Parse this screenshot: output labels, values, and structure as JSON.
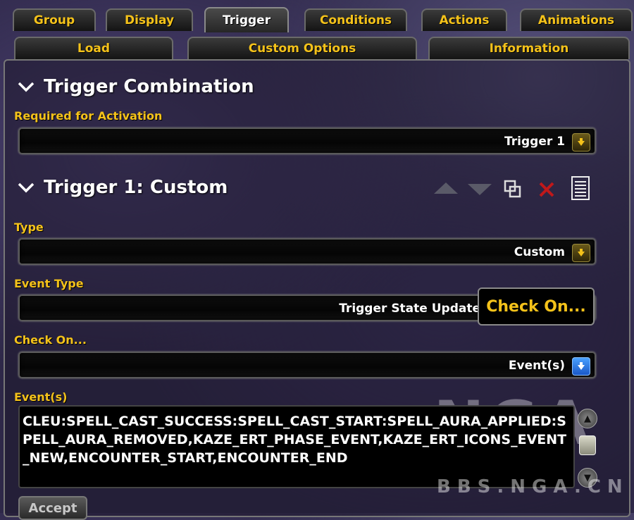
{
  "tabs_row1": [
    {
      "label": "Group",
      "active": false
    },
    {
      "label": "Display",
      "active": false
    },
    {
      "label": "Trigger",
      "active": true
    },
    {
      "label": "Conditions",
      "active": false
    },
    {
      "label": "Actions",
      "active": false
    },
    {
      "label": "Animations",
      "active": false
    }
  ],
  "tabs_row2": [
    {
      "label": "Load"
    },
    {
      "label": "Custom Options"
    },
    {
      "label": "Information"
    }
  ],
  "trigger_combination": {
    "header": "Trigger Combination",
    "required_label": "Required for Activation",
    "required_value": "Trigger 1"
  },
  "trigger1": {
    "header": "Trigger 1: Custom",
    "type_label": "Type",
    "type_value": "Custom",
    "event_type_label": "Event Type",
    "event_type_value": "Trigger State Update",
    "check_on_label": "Check On...",
    "check_on_value": "Event(s)",
    "events_label": "Event(s)",
    "events_value": "CLEU:SPELL_CAST_SUCCESS:SPELL_CAST_START:SPELL_AURA_APPLIED:SPELL_AURA_REMOVED,KAZE_ERT_PHASE_EVENT,KAZE_ERT_ICONS_EVENT_NEW,ENCOUNTER_START,ENCOUNTER_END"
  },
  "tooltip": "Check On...",
  "accept_label": "Accept",
  "watermark": {
    "logo": "NGA",
    "text": "BBS.NGA.CN"
  },
  "colors": {
    "accent": "#f4c21a",
    "text": "#ffffff",
    "delete": "#c0181a",
    "dropdown_btn_blue": "#2a78e8"
  },
  "icons": [
    "chevron-down-icon",
    "arrow-up-icon",
    "arrow-down-icon",
    "duplicate-icon",
    "delete-icon",
    "document-icon",
    "dropdown-arrow-icon"
  ]
}
